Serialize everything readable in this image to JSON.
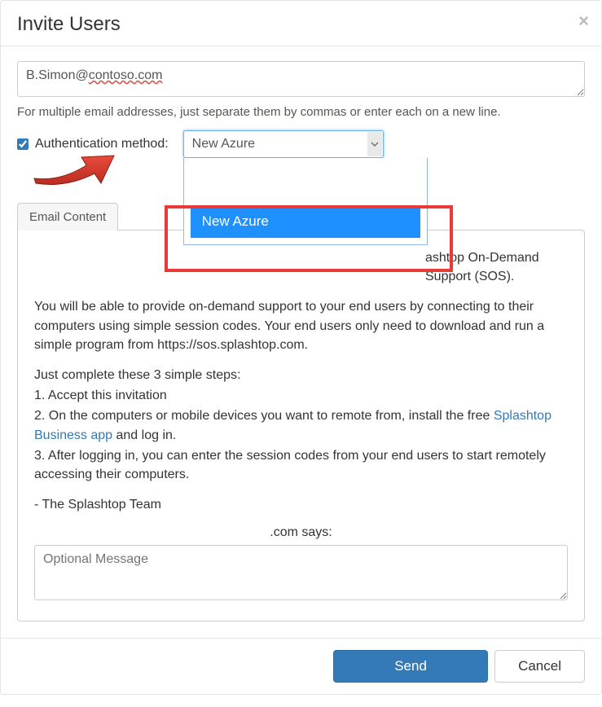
{
  "modal": {
    "title": "Invite Users",
    "close_label": "×"
  },
  "email": {
    "value": "B.Simon@contoso.com",
    "hint": "For multiple email addresses, just separate them by commas or enter each on a new line."
  },
  "auth": {
    "checked": true,
    "label": "Authentication method:",
    "selected": "New Azure",
    "options": {
      "highlighted": "New Azure"
    }
  },
  "tabs": {
    "email_content": "Email Content"
  },
  "content": {
    "p1_suffix": "ashtop On-Demand Support (SOS).",
    "p2": "You will be able to provide on-demand support to your end users by connecting to their computers using simple session codes. Your end users only need to download and run a simple program from https://sos.splashtop.com.",
    "p3": "Just complete these 3 simple steps:",
    "step1": "1. Accept this invitation",
    "step2_prefix": "2. On the computers or mobile devices you want to remote from, install the free ",
    "step2_link": "Splashtop Business app",
    "step2_suffix": " and log in.",
    "step3": "3. After logging in, you can enter the session codes from your end users to start remotely accessing their computers.",
    "signoff": "- The Splashtop Team",
    "says": ".com says:",
    "optional_placeholder": "Optional Message"
  },
  "footer": {
    "send": "Send",
    "cancel": "Cancel"
  }
}
